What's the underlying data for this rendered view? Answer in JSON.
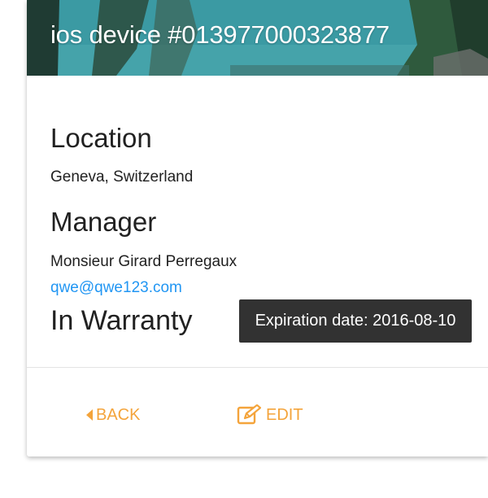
{
  "header": {
    "title": "ios device #013977000323877"
  },
  "location": {
    "heading": "Location",
    "value": "Geneva, Switzerland"
  },
  "manager": {
    "heading": "Manager",
    "name": "Monsieur Girard Perregaux",
    "email": "qwe@qwe123.com"
  },
  "warranty": {
    "status": "In Warranty",
    "tooltip": "Expiration date: 2016-08-10"
  },
  "actions": {
    "back_label": "BACK",
    "back_icon": "caret-left-icon",
    "edit_label": "EDIT",
    "edit_icon": "edit-icon"
  },
  "colors": {
    "accent": "#f4a43b",
    "link": "#2196f3",
    "tooltip_bg": "#323232"
  }
}
